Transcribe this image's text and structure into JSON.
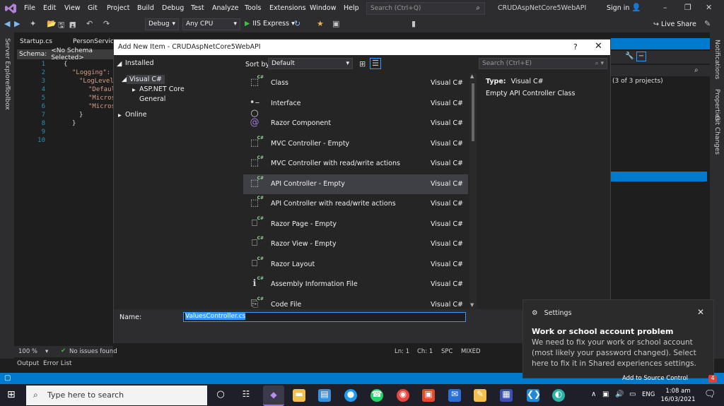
{
  "menu": [
    "File",
    "Edit",
    "View",
    "Git",
    "Project",
    "Build",
    "Debug",
    "Test",
    "Analyze",
    "Tools",
    "Extensions",
    "Window",
    "Help"
  ],
  "vs_search_placeholder": "Search (Ctrl+Q)",
  "project_title": "CRUDAspNetCore5WebAPI",
  "sign_in": "Sign in",
  "toolbar": {
    "config": "Debug",
    "platform": "Any CPU",
    "run_target": "IIS Express",
    "live_share": "Live Share"
  },
  "left_strip": [
    "Server Explorer",
    "Toolbox"
  ],
  "right_strip": [
    "Notifications",
    "Properties",
    "Git Changes"
  ],
  "editor": {
    "tabs": [
      "Startup.cs",
      "PersonService"
    ],
    "schema": "Schema:",
    "schema_value": "<No Schema Selected>",
    "line_numbers": [
      "1",
      "2",
      "3",
      "4",
      "5",
      "6",
      "7",
      "8",
      "9",
      "10"
    ],
    "code_lines": [
      "{",
      "\"Logging\":",
      "\"LogLevel",
      "\"Defaul",
      "\"Micros",
      "\"Micros",
      "}",
      "}",
      "",
      ""
    ]
  },
  "solution_explorer": {
    "projects": "(3 of 3 projects)"
  },
  "editor_status": {
    "zoom": "100 %",
    "issues": "No issues found",
    "ln": "Ln: 1",
    "ch": "Ch: 1",
    "spc": "SPC",
    "mixed": "MIXED"
  },
  "output_tabs": [
    "Output",
    "Error List"
  ],
  "dialog": {
    "title": "Add New Item - CRUDAspNetCore5WebAPI",
    "help": "?",
    "installed": "Installed",
    "tree": {
      "root": "Visual C#",
      "children": [
        "ASP.NET Core",
        "General"
      ],
      "online": "Online"
    },
    "sort_by_label": "Sort by:",
    "sort_by_value": "Default",
    "search_placeholder": "Search (Ctrl+E)",
    "templates": [
      {
        "name": "Class",
        "lang": "Visual C#",
        "icon": "class-icon"
      },
      {
        "name": "Interface",
        "lang": "Visual C#",
        "icon": "interface-icon"
      },
      {
        "name": "Razor Component",
        "lang": "Visual C#",
        "icon": "razor-component-icon"
      },
      {
        "name": "MVC Controller - Empty",
        "lang": "Visual C#",
        "icon": "controller-icon"
      },
      {
        "name": "MVC Controller with read/write actions",
        "lang": "Visual C#",
        "icon": "controller-icon"
      },
      {
        "name": "API Controller - Empty",
        "lang": "Visual C#",
        "icon": "controller-icon"
      },
      {
        "name": "API Controller with read/write actions",
        "lang": "Visual C#",
        "icon": "controller-icon"
      },
      {
        "name": "Razor Page - Empty",
        "lang": "Visual C#",
        "icon": "razor-page-icon"
      },
      {
        "name": "Razor View - Empty",
        "lang": "Visual C#",
        "icon": "razor-view-icon"
      },
      {
        "name": "Razor Layout",
        "lang": "Visual C#",
        "icon": "razor-layout-icon"
      },
      {
        "name": "Assembly Information File",
        "lang": "Visual C#",
        "icon": "assembly-info-icon"
      },
      {
        "name": "Code File",
        "lang": "Visual C#",
        "icon": "code-file-icon"
      }
    ],
    "selected_index": 5,
    "type_label": "Type:",
    "type_value": "Visual C#",
    "type_description": "Empty API Controller Class",
    "name_label": "Name:",
    "name_value": "ValuesController.cs"
  },
  "notification": {
    "header": "Settings",
    "title": "Work or school account problem",
    "body": "We need to fix your work or school account (most likely your password changed). Select here to fix it in Shared experiences settings.",
    "peek": "Add to Source Control"
  },
  "taskbar": {
    "search_placeholder": "Type here to search",
    "language": "ENG",
    "time": "1:08 am",
    "date": "16/03/2021",
    "notif_count": "4"
  }
}
